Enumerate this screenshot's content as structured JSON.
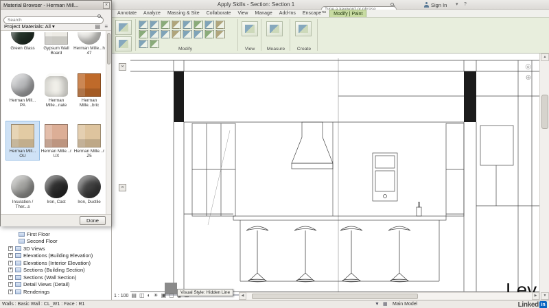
{
  "titlebar": {
    "app_title": "Apply Skills - Section: Section 1",
    "search_placeholder": "Type a keyword or phrase",
    "sign_in_label": "Sign In"
  },
  "ribbon": {
    "tabs": [
      "Annotate",
      "Analyze",
      "Massing & Site",
      "Collaborate",
      "View",
      "Manage",
      "Add-Ins",
      "Enscape™",
      "Modify | Paint"
    ],
    "active_tab": "Modify | Paint",
    "panel_labels": {
      "modify": "Modify",
      "view": "View",
      "measure": "Measure",
      "create": "Create"
    }
  },
  "material_browser": {
    "title": "Material Browser - Herman Mill...",
    "search_placeholder": "Search",
    "filter_label": "Project Materials: All",
    "view_icons": [
      "▤",
      "≡"
    ],
    "done_label": "Done",
    "materials": [
      {
        "name": "Green Glass",
        "shape": "sphere",
        "color": "#26352b"
      },
      {
        "name": "Gypsum Wall Board",
        "shape": "cube",
        "color": "#eceae4"
      },
      {
        "name": "Herman Mille...h 47",
        "shape": "sphere",
        "color": "#f0efeb"
      },
      {
        "name": "Herman Mill... PA",
        "shape": "sphere",
        "color": "#b9babc"
      },
      {
        "name": "Herman Mille...nate",
        "shape": "cylinder",
        "color": "#f1f0ea"
      },
      {
        "name": "Herman Mille...bric",
        "shape": "cube",
        "color": "#bf6a2a"
      },
      {
        "name": "Herman Mill... OU",
        "shape": "cube",
        "color": "#e2cba4",
        "selected": true
      },
      {
        "name": "Herman Mille...r UX",
        "shape": "cube",
        "color": "#dcae96"
      },
      {
        "name": "Herman Mille...r Z5",
        "shape": "cube",
        "color": "#dec49e"
      },
      {
        "name": "Insulation / Ther...s",
        "shape": "sphere",
        "color": "#a3a3a0"
      },
      {
        "name": "Iron, Cast",
        "shape": "sphere",
        "color": "#2e2e2e"
      },
      {
        "name": "Iron, Ductile",
        "shape": "sphere",
        "color": "#424242"
      }
    ]
  },
  "project_browser": {
    "items": [
      {
        "label": "First Floor",
        "expandable": false
      },
      {
        "label": "Second Floor",
        "expandable": false
      },
      {
        "label": "3D Views",
        "expandable": true
      },
      {
        "label": "Elevations (Building Elevation)",
        "expandable": true
      },
      {
        "label": "Elevations (Interior Elevation)",
        "expandable": true
      },
      {
        "label": "Sections (Building Section)",
        "expandable": true
      },
      {
        "label": "Sections (Wall Section)",
        "expandable": true
      },
      {
        "label": "Detail Views (Detail)",
        "expandable": true
      },
      {
        "label": "Renderings",
        "expandable": true
      }
    ]
  },
  "canvas": {
    "level_label": "Lev",
    "nav_icons": [
      "◎",
      "⊕"
    ]
  },
  "view_bar": {
    "scale": "1 : 100",
    "icons": [
      "▤",
      "◫",
      "◐",
      "☀",
      "▣",
      "▢",
      "◉",
      "⊞"
    ],
    "tooltip": "Visual Style: Hidden Line"
  },
  "status_bar": {
    "selection_info": "Walls : Basic Wall : CL_W1 : Face : R1",
    "icons": [
      "▼",
      "▦"
    ],
    "model_label": "Main Model"
  },
  "watermark": {
    "text": "Linked",
    "badge": "in"
  },
  "icons": {
    "close": "×",
    "dropdown": "▾",
    "tree_expand": "+",
    "scroll_up": "▲",
    "scroll_down": "▼",
    "scroll_left": "◀",
    "scroll_right": "▶",
    "help": "?"
  },
  "colors": {
    "active_tab_green": "#c8dba2",
    "ribbon_bg": "#e8eedd",
    "selection_blue": "#cfe2f6",
    "linkedin_blue": "#0a66c2",
    "wall_poche": "#1b1b1b"
  }
}
